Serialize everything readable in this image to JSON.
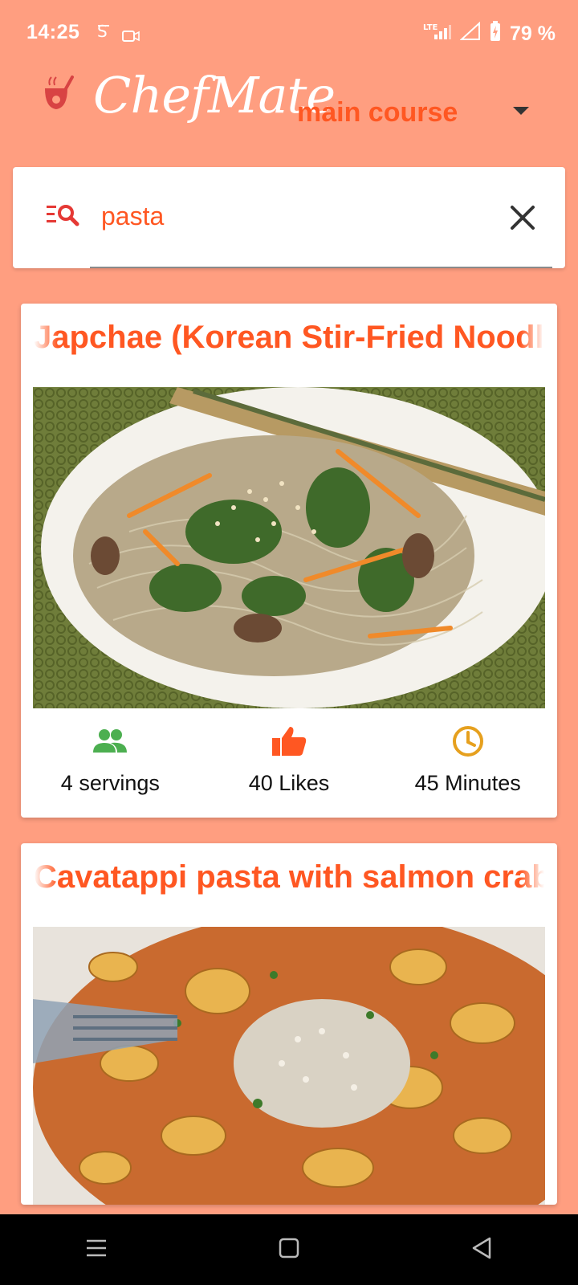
{
  "status_bar": {
    "time": "14:25",
    "battery_percent": "79 %",
    "network": "LTE"
  },
  "app": {
    "title": "ChefMate",
    "logo_icon": "ladle-pot-icon"
  },
  "category_dropdown": {
    "selected": "main course"
  },
  "search": {
    "value": "pasta",
    "icon": "search-list-icon",
    "clear_icon": "close-icon"
  },
  "recipes": [
    {
      "title": "Japchae (Korean Stir-Fried Noodles)",
      "image": "japchae-noodles-photo",
      "servings": "4 servings",
      "likes": "40 Likes",
      "time": "45 Minutes"
    },
    {
      "title": "Cavatappi pasta with salmon crab",
      "image": "cavatappi-pasta-photo"
    }
  ],
  "colors": {
    "background": "#FF9E80",
    "accent": "#FF5722",
    "servings_icon": "#4CAF50",
    "likes_icon": "#FF5722",
    "time_icon": "#E6A01E"
  }
}
